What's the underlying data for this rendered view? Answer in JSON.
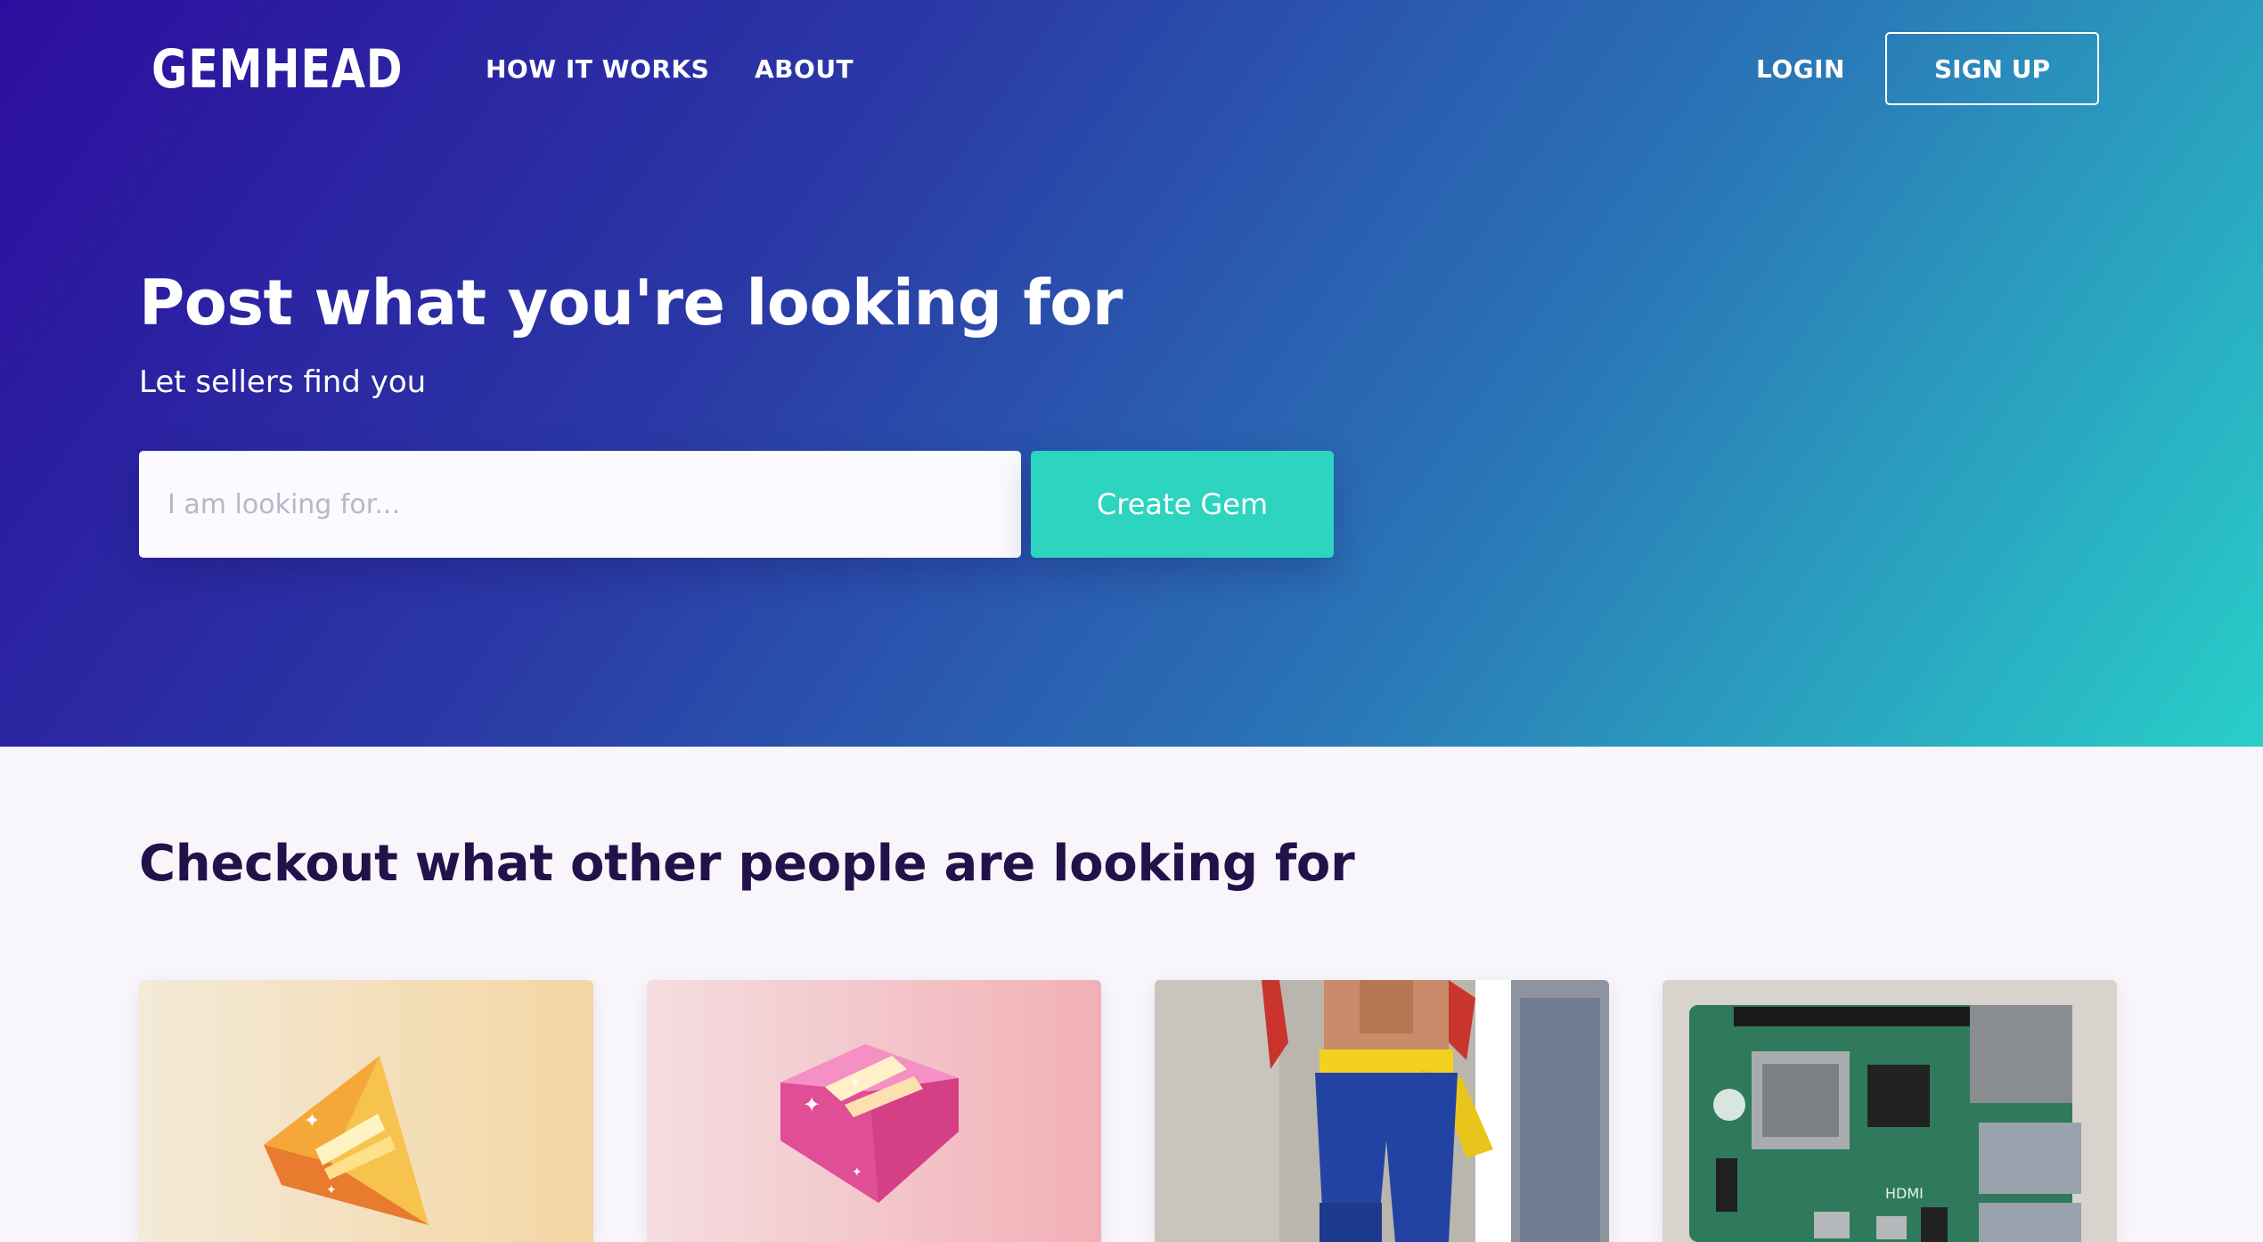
{
  "brand": {
    "name": "GEMHEAD",
    "logo_icon": "gem-logo-icon",
    "accent_color": "#2dd4bf"
  },
  "nav": {
    "how_it_works": "HOW IT WORKS",
    "about": "ABOUT",
    "login": "LOGIN",
    "signup": "SIGN UP"
  },
  "hero": {
    "title": "Post what you're looking for",
    "subtitle": "Let sellers find you",
    "search_placeholder": "I am looking for...",
    "search_value": "",
    "create_button": "Create Gem",
    "gradient_colors": [
      "#2c0e9e",
      "#29cfc9"
    ]
  },
  "listings": {
    "title": "Checkout what other people are looking for",
    "cards": [
      {
        "image": "orange-gem-illustration",
        "background": "#f4d9a8"
      },
      {
        "image": "pink-gem-illustration",
        "background": "#f3b6bd"
      },
      {
        "image": "anime-figure-photo",
        "background": "#b7b4ad"
      },
      {
        "image": "raspberry-pi-board-photo",
        "background": "#d9d4cd"
      }
    ]
  }
}
